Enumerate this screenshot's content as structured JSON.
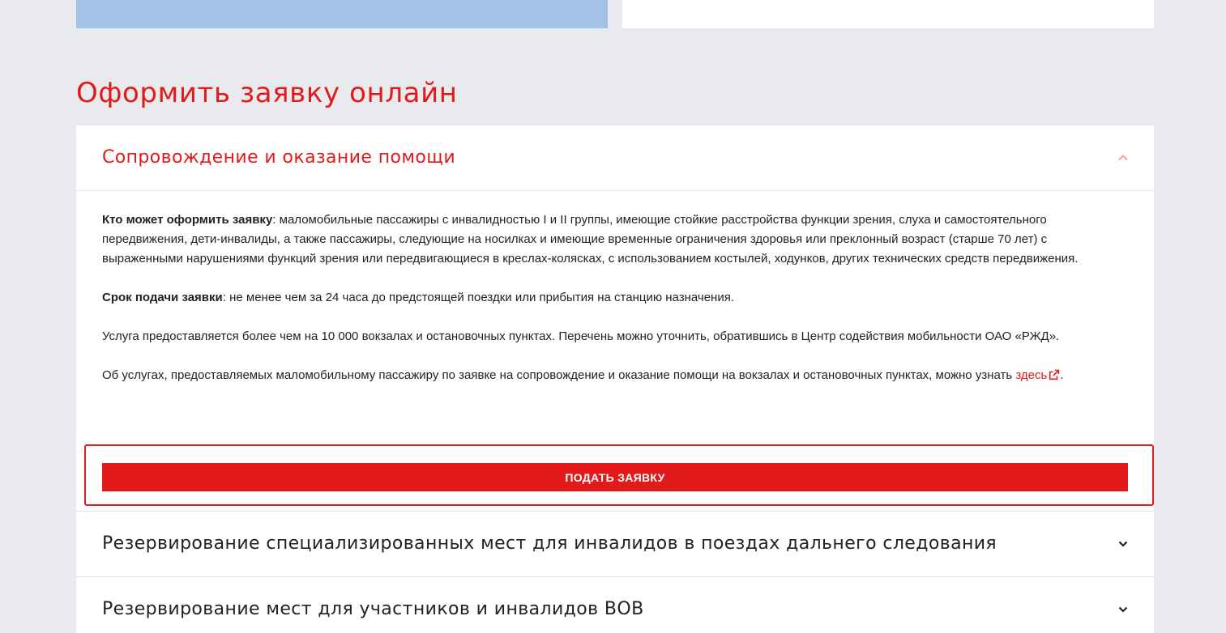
{
  "page": {
    "title": "Оформить заявку онлайн"
  },
  "colors": {
    "accent": "#e21a1a",
    "background": "#e9eaee",
    "card_blue": "#a3c2e8"
  },
  "accordion": {
    "items": [
      {
        "title": "Сопровождение и оказание помощи",
        "expanded": true,
        "icon": "chevron-up-icon",
        "who_label": "Кто может оформить заявку",
        "who_text": ": маломобильные пассажиры с инвалидностью I и II группы, имеющие стойкие расстройства функции зрения, слуха и самостоятельного передвижения, дети-инвалиды, а также пассажиры, следующие на носилках и имеющие временные ограничения здоровья или преклонный возраст (старше 70 лет) с выраженными нарушениями функций зрения или передвигающиеся в креслах-колясках, с использованием костылей, ходунков, других технических средств передвижения.",
        "deadline_label": "Срок подачи заявки",
        "deadline_text": ": не менее чем за 24 часа до предстоящей поездки или прибытия на станцию назначения.",
        "service_text": "Услуга предоставляется более чем на 10 000 вокзалах и остановочных пунктах. Перечень можно уточнить, обратившись в Центр содействия мобильности ОАО «РЖД».",
        "info_text": "Об услугах, предоставляемых маломобильному пассажиру по заявке на сопровождение и оказание помощи на вокзалах и остановочных пунктах, можно узнать ",
        "info_link": "здесь",
        "info_end": ".",
        "submit_label": "Подать заявку"
      },
      {
        "title": "Резервирование специализированных мест для инвалидов в поездах дальнего следования",
        "expanded": false,
        "icon": "chevron-down-icon"
      },
      {
        "title": "Резервирование мест для участников и инвалидов ВОВ",
        "expanded": false,
        "icon": "chevron-down-icon"
      }
    ]
  }
}
